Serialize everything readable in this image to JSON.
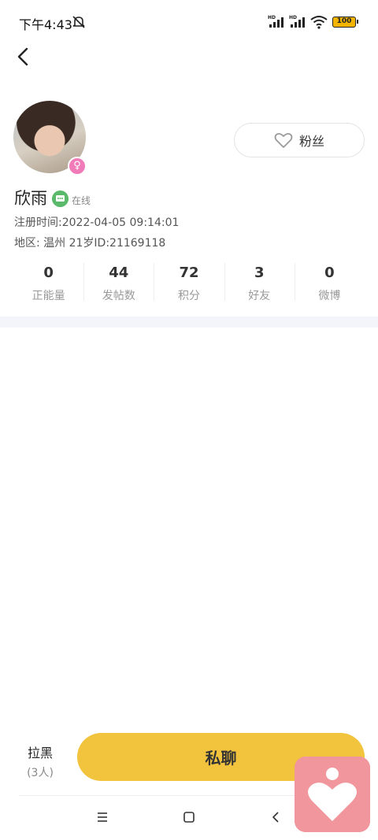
{
  "status_bar": {
    "time": "下午4:43",
    "battery": "100",
    "signal_label": "HD"
  },
  "profile": {
    "name": "欣雨",
    "online_status": "在线",
    "register_time": "注册时间:2022-04-05 09:14:01",
    "region_info": "地区: 温州   21岁ID:21169118",
    "gender_symbol": "♀"
  },
  "fans_button": {
    "label": "粉丝"
  },
  "stats": [
    {
      "value": "0",
      "label": "正能量"
    },
    {
      "value": "44",
      "label": "发帖数"
    },
    {
      "value": "72",
      "label": "积分"
    },
    {
      "value": "3",
      "label": "好友"
    },
    {
      "value": "0",
      "label": "微博"
    }
  ],
  "bottom_bar": {
    "blacklist_label": "拉黑",
    "blacklist_count": "(3人)",
    "chat_label": "私聊"
  },
  "colors": {
    "accent": "#f2c33d",
    "online": "#5bb96b",
    "female": "#f07bb8",
    "float_app": "#f0969c"
  }
}
